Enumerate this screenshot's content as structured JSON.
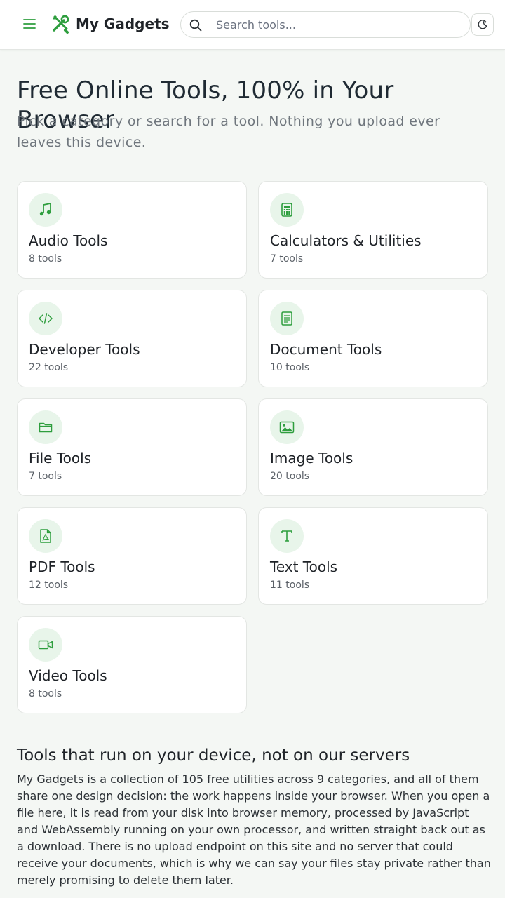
{
  "header": {
    "brand": "My Gadgets",
    "search_placeholder": "Search tools...",
    "icons": {
      "menu": "hamburger-icon",
      "logo": "tools-icon",
      "search": "search-icon",
      "theme": "moon-icon"
    }
  },
  "colors": {
    "accent": "#2e9e3e",
    "icon_bg": "#e8f5ea",
    "page_bg": "#f4f7f4"
  },
  "hero": {
    "title": "Free Online Tools, 100% in Your Browser",
    "subtitle": "Pick a category or search for a tool. Nothing you upload ever leaves this device."
  },
  "categories": [
    {
      "title": "Audio Tools",
      "count": "8 tools",
      "icon": "music-note-icon"
    },
    {
      "title": "Calculators & Utilities",
      "count": "7 tools",
      "icon": "calculator-icon"
    },
    {
      "title": "Developer Tools",
      "count": "22 tools",
      "icon": "code-icon"
    },
    {
      "title": "Document Tools",
      "count": "10 tools",
      "icon": "document-icon"
    },
    {
      "title": "File Tools",
      "count": "7 tools",
      "icon": "folder-icon"
    },
    {
      "title": "Image Tools",
      "count": "20 tools",
      "icon": "image-icon"
    },
    {
      "title": "PDF Tools",
      "count": "12 tools",
      "icon": "pdf-icon"
    },
    {
      "title": "Text Tools",
      "count": "11 tools",
      "icon": "text-icon"
    },
    {
      "title": "Video Tools",
      "count": "8 tools",
      "icon": "video-icon"
    }
  ],
  "about": {
    "title": "Tools that run on your device, not on our servers",
    "body": "My Gadgets is a collection of 105 free utilities across 9 categories, and all of them share one design decision: the work happens inside your browser. When you open a file here, it is read from your disk into browser memory, processed by JavaScript and WebAssembly running on your own processor, and written straight back out as a download. There is no upload endpoint on this site and no server that could receive your documents, which is why we can say your files stay private rather than merely promising to delete them later."
  }
}
